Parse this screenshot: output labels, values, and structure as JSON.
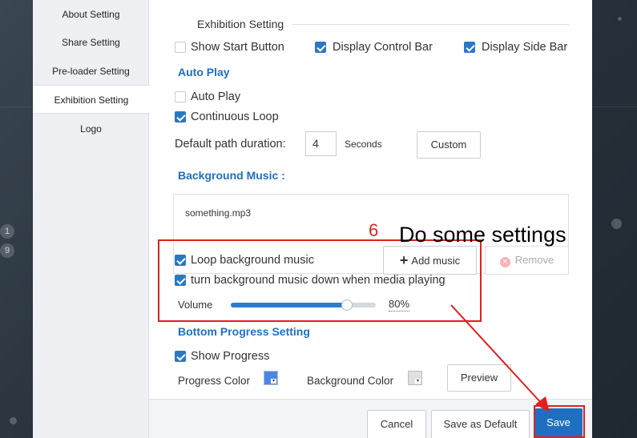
{
  "sidebar": {
    "items": [
      {
        "label": "About Setting",
        "active": false
      },
      {
        "label": "Share Setting",
        "active": false
      },
      {
        "label": "Pre-loader Setting",
        "active": false
      },
      {
        "label": "Exhibition Setting",
        "active": true
      },
      {
        "label": "Logo",
        "active": false
      }
    ]
  },
  "background_pages": [
    "1",
    "9"
  ],
  "exhibition": {
    "title": "Exhibition Setting",
    "show_start_button": {
      "label": "Show Start Button",
      "checked": false
    },
    "display_control_bar": {
      "label": "Display Control Bar",
      "checked": true
    },
    "display_side_bar": {
      "label": "Display Side Bar",
      "checked": true
    }
  },
  "auto_play": {
    "heading": "Auto Play",
    "auto_play": {
      "label": "Auto Play",
      "checked": false
    },
    "continuous_loop": {
      "label": "Continuous Loop",
      "checked": true
    },
    "duration_label": "Default path duration:",
    "duration_value": "4",
    "duration_unit": "Seconds",
    "custom_label": "Custom"
  },
  "music": {
    "heading": "Background Music :",
    "file": "something.mp3",
    "loop": {
      "label": "Loop background music",
      "checked": true
    },
    "turn_down": {
      "label": "turn background music down when media playing",
      "checked": true
    },
    "add_label": "Add music",
    "remove_label": "Remove",
    "volume_label": "Volume",
    "volume_value": "80%",
    "volume_fraction": 0.8
  },
  "progress": {
    "heading": "Bottom Progress Setting",
    "show_progress": {
      "label": "Show Progress",
      "checked": true
    },
    "progress_color_label": "Progress Color",
    "progress_color": "#4a86e8",
    "background_color_label": "Background Color",
    "background_color": "#e0e0e0",
    "preview_label": "Preview"
  },
  "footer": {
    "cancel_label": "Cancel",
    "save_default_label": "Save as Default",
    "save_label": "Save"
  },
  "annotation": {
    "step": "6",
    "text": "Do some settings",
    "color": "#e02020"
  }
}
